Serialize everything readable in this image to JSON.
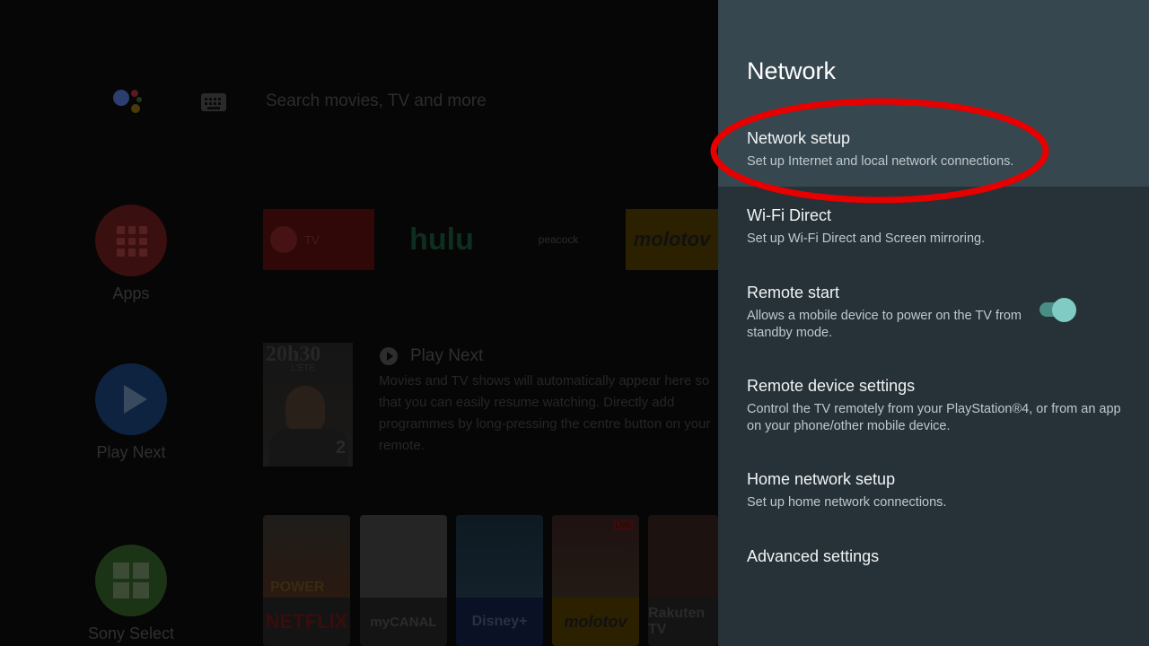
{
  "home": {
    "search_placeholder": "Search movies, TV and more",
    "sidebar": [
      {
        "label": "Apps",
        "icon": "apps-grid-icon"
      },
      {
        "label": "Play Next",
        "icon": "play-icon"
      },
      {
        "label": "Sony Select",
        "icon": "sony-select-icon"
      }
    ],
    "channels": {
      "tv": "TV",
      "hulu": "hulu",
      "peacock": "peacock",
      "molotov": "molotov"
    },
    "promo": {
      "title": "20h30",
      "subtitle": "L'ETE",
      "badge": "2"
    },
    "play_next": {
      "heading": "Play Next",
      "description": "Movies and TV shows will automatically appear here so that you can easily resume watching. Directly add programmes by long-pressing the centre button on your remote."
    },
    "posters": {
      "p1_title": "POWER",
      "p1_logo": "NETFLIX",
      "p2_logo": "myCANAL",
      "p3_logo": "Disney+",
      "p4_badge": "LIVE",
      "p4_logo": "molotov",
      "p5_logo": "Rakuten TV"
    }
  },
  "panel": {
    "title": "Network",
    "items": [
      {
        "title": "Network setup",
        "desc": "Set up Internet and local network connections.",
        "selected": true
      },
      {
        "title": "Wi-Fi Direct",
        "desc": "Set up Wi-Fi Direct and Screen mirroring."
      },
      {
        "title": "Remote start",
        "desc": "Allows a mobile device to power on the TV from standby mode.",
        "toggle": "on"
      },
      {
        "title": "Remote device settings",
        "desc": "Control the TV remotely from your PlayStation®4, or from an app on your phone/other mobile device."
      },
      {
        "title": "Home network setup",
        "desc": "Set up home network connections."
      },
      {
        "title": "Advanced settings"
      }
    ],
    "toggle_color": "#80cbc4",
    "highlight_color": "#e60000"
  }
}
